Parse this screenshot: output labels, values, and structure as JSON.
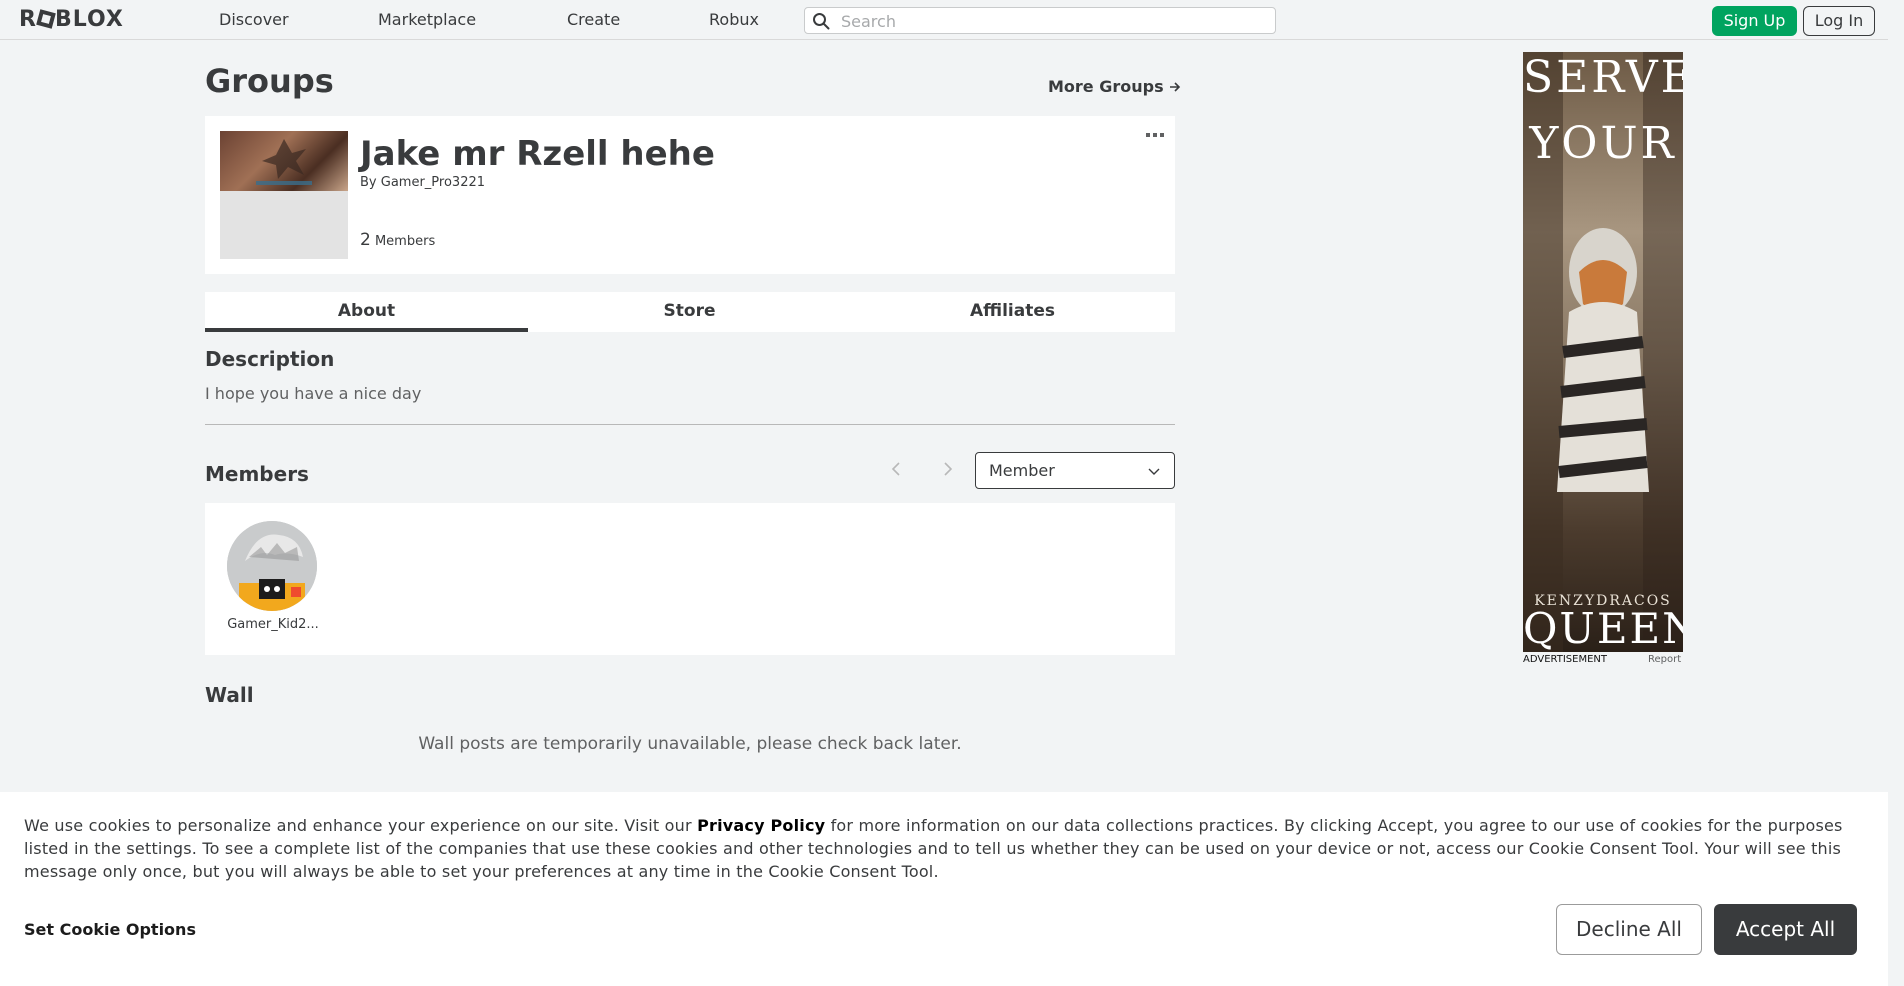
{
  "nav": {
    "logo": "ROBLOX",
    "links": [
      "Discover",
      "Marketplace",
      "Create",
      "Robux"
    ],
    "search_placeholder": "Search",
    "signup_label": "Sign Up",
    "login_label": "Log In"
  },
  "page": {
    "title": "Groups",
    "more_groups_label": "More Groups"
  },
  "group": {
    "name": "Jake mr Rzell hehe",
    "by_label": "By",
    "owner": "Gamer_Pro3221",
    "member_count": "2",
    "members_label": "Members"
  },
  "tabs": [
    {
      "label": "About",
      "active": true
    },
    {
      "label": "Store",
      "active": false
    },
    {
      "label": "Affiliates",
      "active": false
    }
  ],
  "about": {
    "description_heading": "Description",
    "description_text": "I hope you have a nice day",
    "members_heading": "Members",
    "role_selected": "Member",
    "members": [
      {
        "name": "Gamer_Kid2..."
      }
    ],
    "wall_heading": "Wall",
    "wall_message": "Wall posts are temporarily unavailable, please check back later."
  },
  "ad": {
    "line1": "SERVE",
    "line2": "YOUR",
    "byline": "KENZYDRACOS",
    "line3": "QUEEN",
    "label": "ADVERTISEMENT",
    "report": "Report"
  },
  "cookie": {
    "text_before": "We use cookies to personalize and enhance your experience on our site. Visit our ",
    "privacy_link": "Privacy Policy",
    "text_after": " for more information on our data collections practices. By clicking Accept, you agree to our use of cookies for the purposes listed in the settings. To see a complete list of the companies that use these cookies and other technologies and to tell us whether they can be used on your device or not, access our Cookie Consent Tool. Your will see this message only once, but you will always be able to set your preferences at any time in the Cookie Consent Tool.",
    "options_label": "Set Cookie Options",
    "decline_label": "Decline All",
    "accept_label": "Accept All"
  },
  "colors": {
    "accent_green": "#00a45f",
    "text_dark": "#393b3d",
    "page_bg": "#f2f4f5"
  },
  "icons": {
    "search": "search-icon",
    "arrow_right": "arrow-right-icon",
    "more": "more-horizontal-icon",
    "chevron_left": "chevron-left-icon",
    "chevron_right": "chevron-right-icon",
    "chevron_down": "chevron-down-icon"
  }
}
